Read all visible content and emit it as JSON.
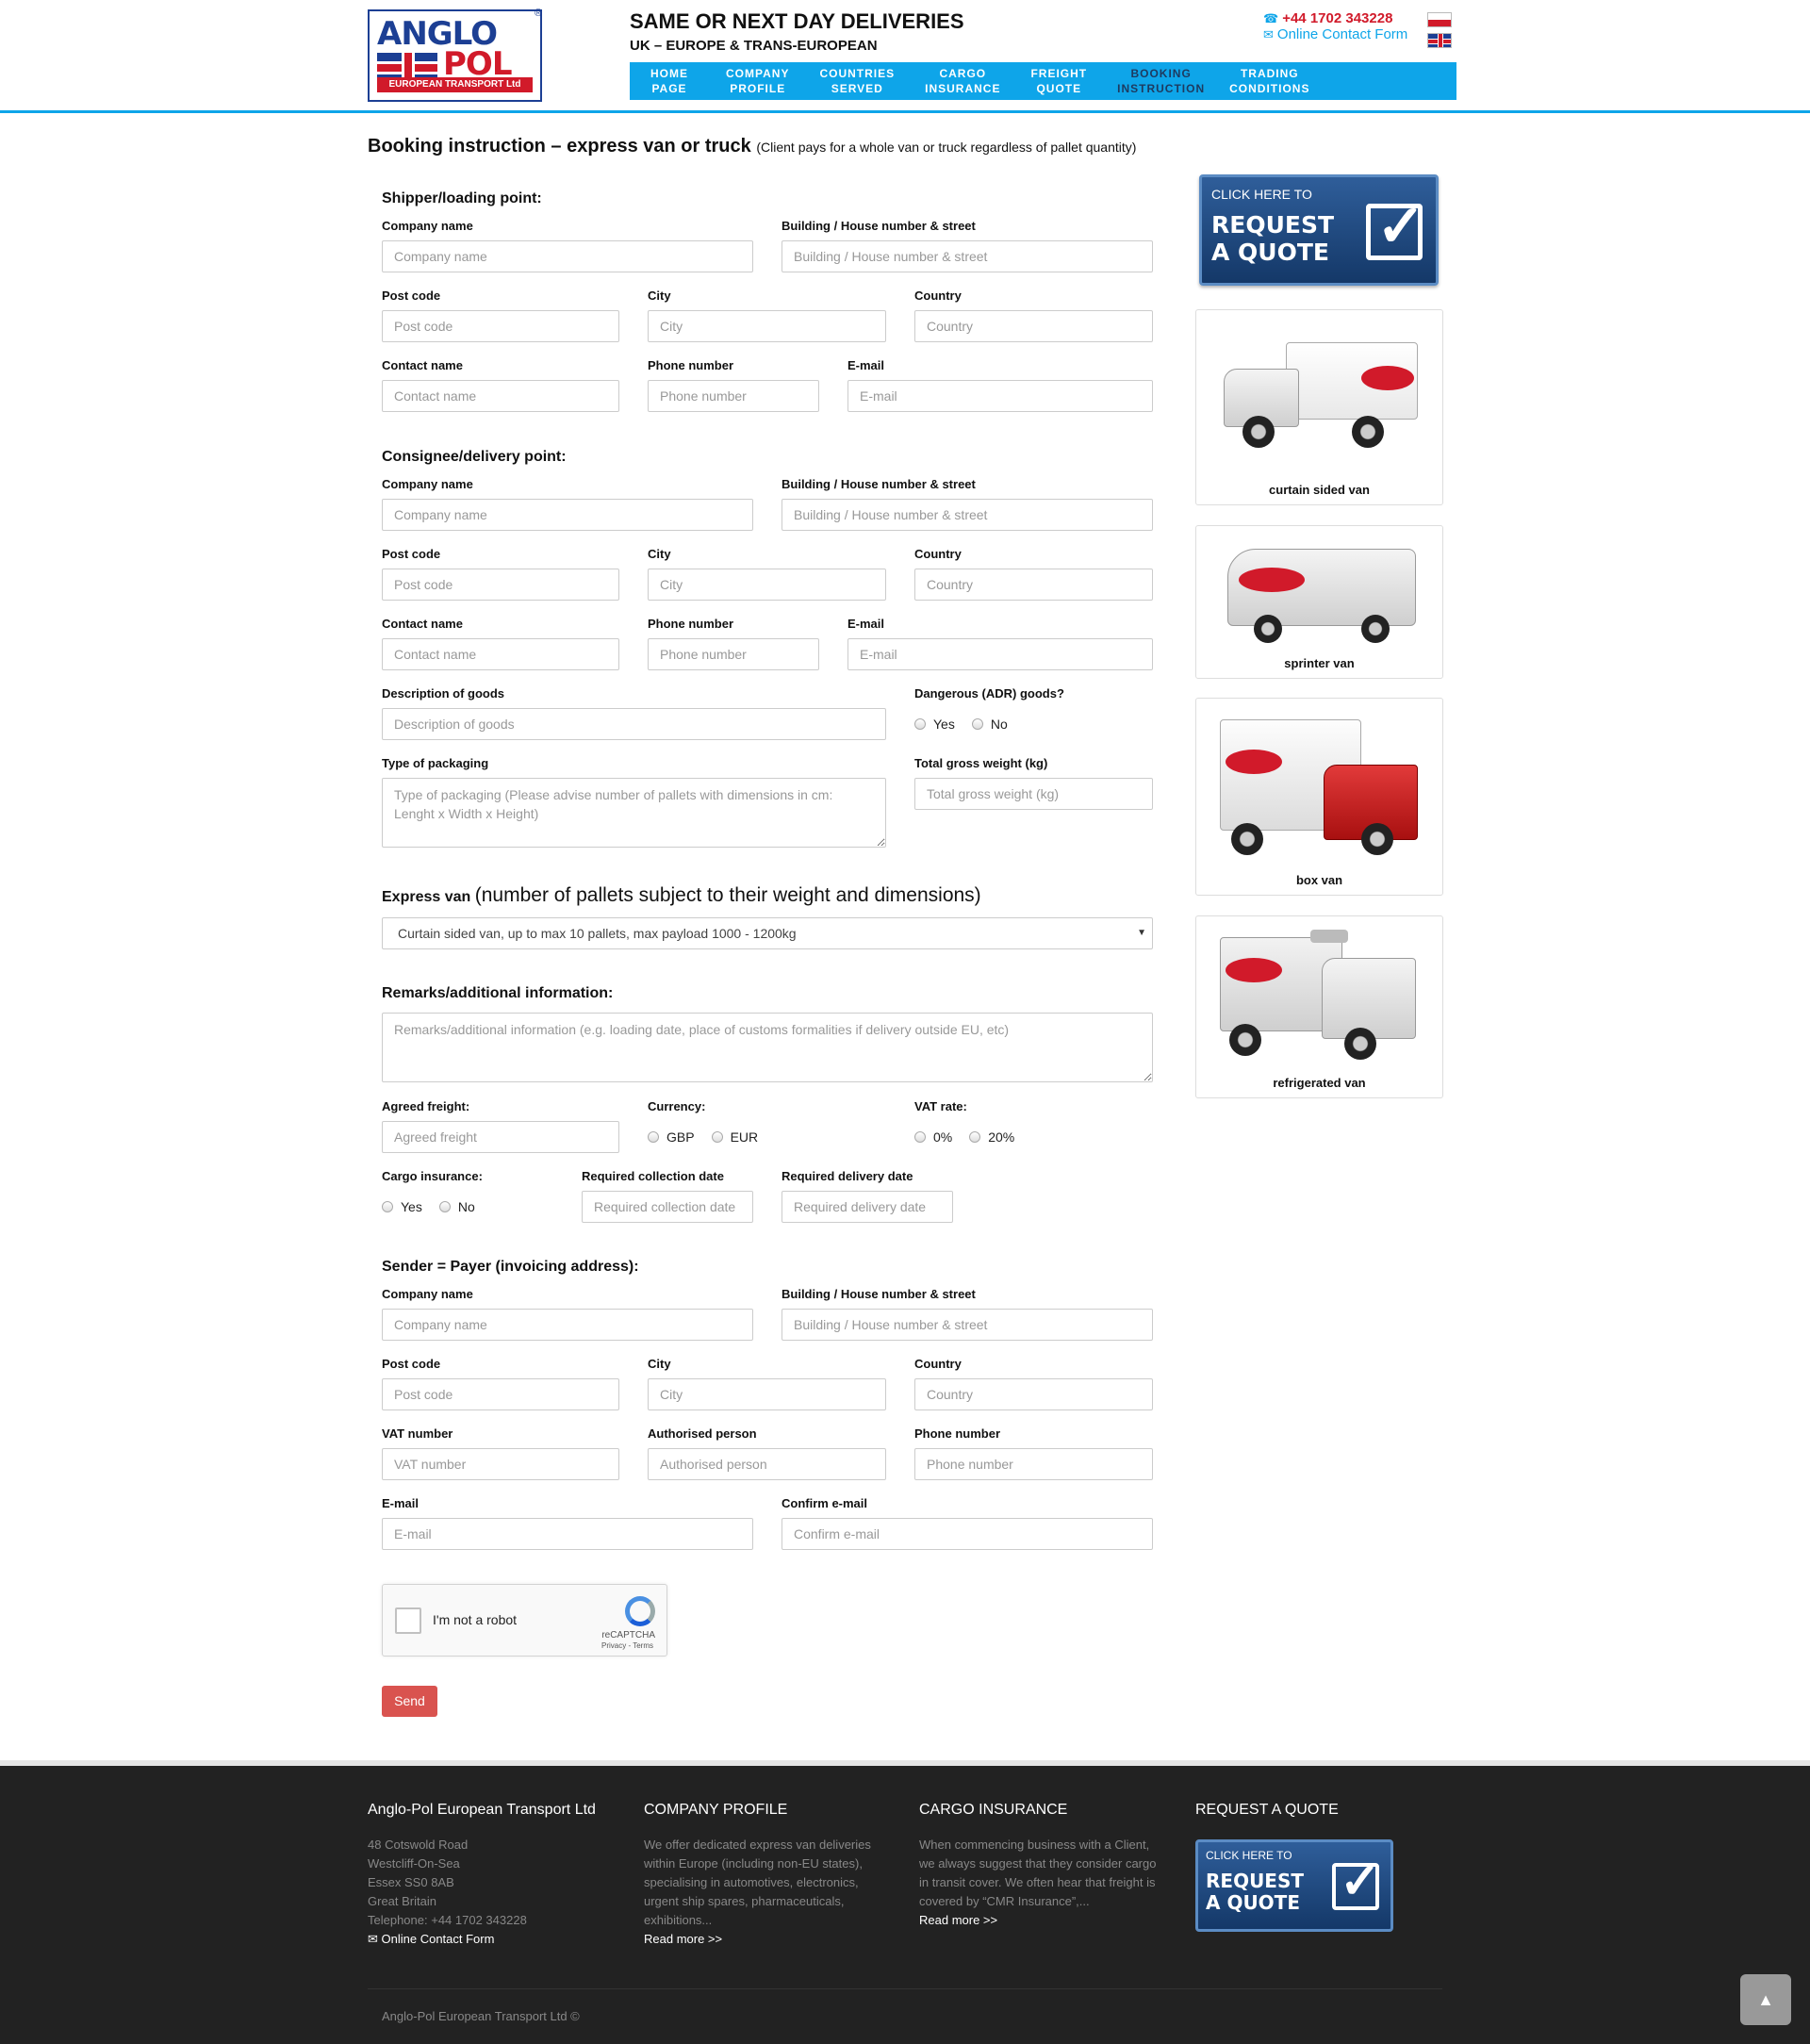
{
  "header": {
    "logo_word1": "ANGLO",
    "logo_word2": "POL",
    "logo_strip": "EUROPEAN TRANSPORT Ltd",
    "tagline1": "SAME OR NEXT DAY DELIVERIES",
    "tagline2": "UK – EUROPE & TRANS-EUROPEAN",
    "phone": "+44 1702 343228",
    "contact_form": "Online Contact Form",
    "nav": [
      {
        "line1": "HOME",
        "line2": "PAGE"
      },
      {
        "line1": "COMPANY",
        "line2": "PROFILE"
      },
      {
        "line1": "COUNTRIES",
        "line2": "SERVED"
      },
      {
        "line1": "CARGO",
        "line2": "INSURANCE"
      },
      {
        "line1": "FREIGHT",
        "line2": "QUOTE"
      },
      {
        "line1": "BOOKING",
        "line2": "INSTRUCTION"
      },
      {
        "line1": "TRADING",
        "line2": "CONDITIONS"
      }
    ]
  },
  "page": {
    "title": "Booking instruction – express van or truck",
    "subtitle": "(Client pays for a whole van or truck regardless of pallet quantity)"
  },
  "shipper": {
    "section": "Shipper/loading point:",
    "company_label": "Company name",
    "company_ph": "Company name",
    "building_label": "Building / House number & street",
    "building_ph": "Building / House number & street",
    "post_label": "Post code",
    "post_ph": "Post code",
    "city_label": "City",
    "city_ph": "City",
    "country_label": "Country",
    "country_ph": "Country",
    "contact_label": "Contact name",
    "contact_ph": "Contact name",
    "phone_label": "Phone number",
    "phone_ph": "Phone number",
    "email_label": "E-mail",
    "email_ph": "E-mail"
  },
  "consignee": {
    "section": "Consignee/delivery point:",
    "company_label": "Company name",
    "company_ph": "Company name",
    "building_label": "Building / House number & street",
    "building_ph": "Building / House number & street",
    "post_label": "Post code",
    "post_ph": "Post code",
    "city_label": "City",
    "city_ph": "City",
    "country_label": "Country",
    "country_ph": "Country",
    "contact_label": "Contact name",
    "contact_ph": "Contact name",
    "phone_label": "Phone number",
    "phone_ph": "Phone number",
    "email_label": "E-mail",
    "email_ph": "E-mail"
  },
  "goods": {
    "desc_label": "Description of goods",
    "desc_ph": "Description of goods",
    "adr_label": "Dangerous (ADR) goods?",
    "adr_yes": "Yes",
    "adr_no": "No",
    "pack_label": "Type of packaging",
    "pack_ph": "Type of packaging (Please advise number of pallets with dimensions in cm: Lenght x Width x Height)",
    "weight_label": "Total gross weight (kg)",
    "weight_ph": "Total gross weight (kg)"
  },
  "express": {
    "label_bold": "Express van",
    "label_light": "(number of pallets subject to their weight and dimensions)",
    "selected": "Curtain sided van, up to max 10 pallets, max payload 1000 - 1200kg"
  },
  "remarks": {
    "section": "Remarks/additional information:",
    "ph": "Remarks/additional information (e.g. loading date, place of customs formalities if delivery outside EU, etc)"
  },
  "freight": {
    "agreed_label": "Agreed freight:",
    "agreed_ph": "Agreed freight",
    "currency_label": "Currency:",
    "gbp": "GBP",
    "eur": "EUR",
    "vat_label": "VAT rate:",
    "vat0": "0%",
    "vat20": "20%",
    "ins_label": "Cargo insurance:",
    "ins_yes": "Yes",
    "ins_no": "No",
    "coll_label": "Required collection date",
    "coll_ph": "Required collection date",
    "deliv_label": "Required delivery date",
    "deliv_ph": "Required delivery date"
  },
  "sender": {
    "section": "Sender = Payer (invoicing address):",
    "company_label": "Company name",
    "company_ph": "Company name",
    "building_label": "Building / House number & street",
    "building_ph": "Building / House number & street",
    "post_label": "Post code",
    "post_ph": "Post code",
    "city_label": "City",
    "city_ph": "City",
    "country_label": "Country",
    "country_ph": "Country",
    "vat_label": "VAT number",
    "vat_ph": "VAT number",
    "auth_label": "Authorised person",
    "auth_ph": "Authorised person",
    "phone_label": "Phone number",
    "phone_ph": "Phone number",
    "email_label": "E-mail",
    "email_ph": "E-mail",
    "confirm_label": "Confirm e-mail",
    "confirm_ph": "Confirm e-mail"
  },
  "captcha": {
    "text": "I'm not a robot",
    "brand": "reCAPTCHA",
    "links": "Privacy - Terms"
  },
  "send": "Send",
  "sidebar": {
    "quote_small": "CLICK HERE TO",
    "quote_big1": "REQUEST",
    "quote_big2": "A QUOTE",
    "vans": [
      "curtain sided van",
      "sprinter van",
      "box van",
      "refrigerated van"
    ]
  },
  "footer": {
    "col1_title": "Anglo-Pol European Transport Ltd",
    "address": [
      "48 Cotswold Road",
      "Westcliff-On-Sea",
      "Essex SS0 8AB",
      "Great Britain",
      "Telephone: +44 1702 343228"
    ],
    "contact_form": "Online Contact Form",
    "col2_title": "COMPANY PROFILE",
    "col2_text": "We offer dedicated express van deliveries within Europe (including non-EU states), specialising in automotives, electronics, urgent ship spares, pharmaceuticals, exhibitions...",
    "col3_title": "CARGO INSURANCE",
    "col3_text": "When commencing business with a Client, we always suggest that they consider cargo in transit cover. We often hear that freight is covered by “CMR Insurance”,...",
    "read_more": "Read more >>",
    "col4_title": "REQUEST A QUOTE",
    "quote_small": "CLICK HERE TO",
    "quote_big1": "REQUEST",
    "quote_big2": "A QUOTE",
    "copyright": "Anglo-Pol European Transport Ltd ©"
  },
  "colors": {
    "accent": "#0ea5e9",
    "brand_red": "#d11a2a",
    "brand_blue": "#1c3f94",
    "send": "#d9534f",
    "footer_bg": "#222222"
  }
}
